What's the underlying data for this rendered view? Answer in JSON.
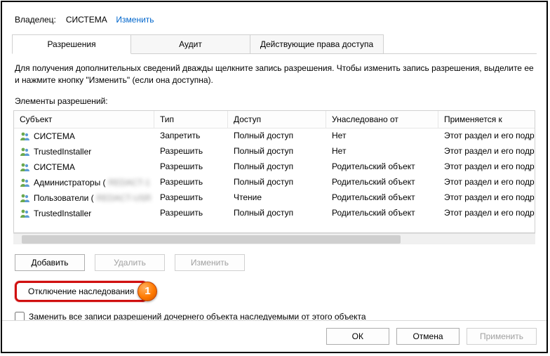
{
  "owner": {
    "label": "Владелец:",
    "value": "СИСТЕМА",
    "change": "Изменить"
  },
  "tabs": {
    "t1": "Разрешения",
    "t2": "Аудит",
    "t3": "Действующие права доступа"
  },
  "info": "Для получения дополнительных сведений дважды щелкните запись разрешения. Чтобы изменить запись разрешения, выделите ее и нажмите кнопку \"Изменить\" (если она доступна).",
  "elementsLabel": "Элементы разрешений:",
  "headers": {
    "subject": "Субъект",
    "type": "Тип",
    "access": "Доступ",
    "inherited": "Унаследовано от",
    "applies": "Применяется к"
  },
  "rows": [
    {
      "subject": "СИСТЕМА",
      "type": "Запретить",
      "access": "Полный доступ",
      "inherited": "Нет",
      "applies": "Этот раздел и его подр"
    },
    {
      "subject": "TrustedInstaller",
      "type": "Разрешить",
      "access": "Полный доступ",
      "inherited": "Нет",
      "applies": "Этот раздел и его подр"
    },
    {
      "subject": "СИСТЕМА",
      "type": "Разрешить",
      "access": "Полный доступ",
      "inherited": "Родительский объект",
      "applies": "Этот раздел и его подр"
    },
    {
      "subject": "Администраторы (",
      "subjectExtra": "REDACT-1",
      "subjectClose": "",
      "type": "Разрешить",
      "access": "Полный доступ",
      "inherited": "Родительский объект",
      "applies": "Этот раздел и его подр"
    },
    {
      "subject": "Пользователи (",
      "subjectExtra": "REDACT-USR",
      "subjectClose": "",
      "type": "Разрешить",
      "access": "Чтение",
      "inherited": "Родительский объект",
      "applies": "Этот раздел и его подр"
    },
    {
      "subject": "TrustedInstaller",
      "type": "Разрешить",
      "access": "Полный доступ",
      "inherited": "Родительский объект",
      "applies": "Этот раздел и его подр"
    }
  ],
  "buttons": {
    "add": "Добавить",
    "remove": "Удалить",
    "edit": "Изменить",
    "disableInherit": "Отключение наследования"
  },
  "badge": "1",
  "checkboxLabel": "Заменить все записи разрешений дочернего объекта наследуемыми от этого объекта",
  "dialog": {
    "ok": "ОК",
    "cancel": "Отмена",
    "apply": "Применить"
  }
}
